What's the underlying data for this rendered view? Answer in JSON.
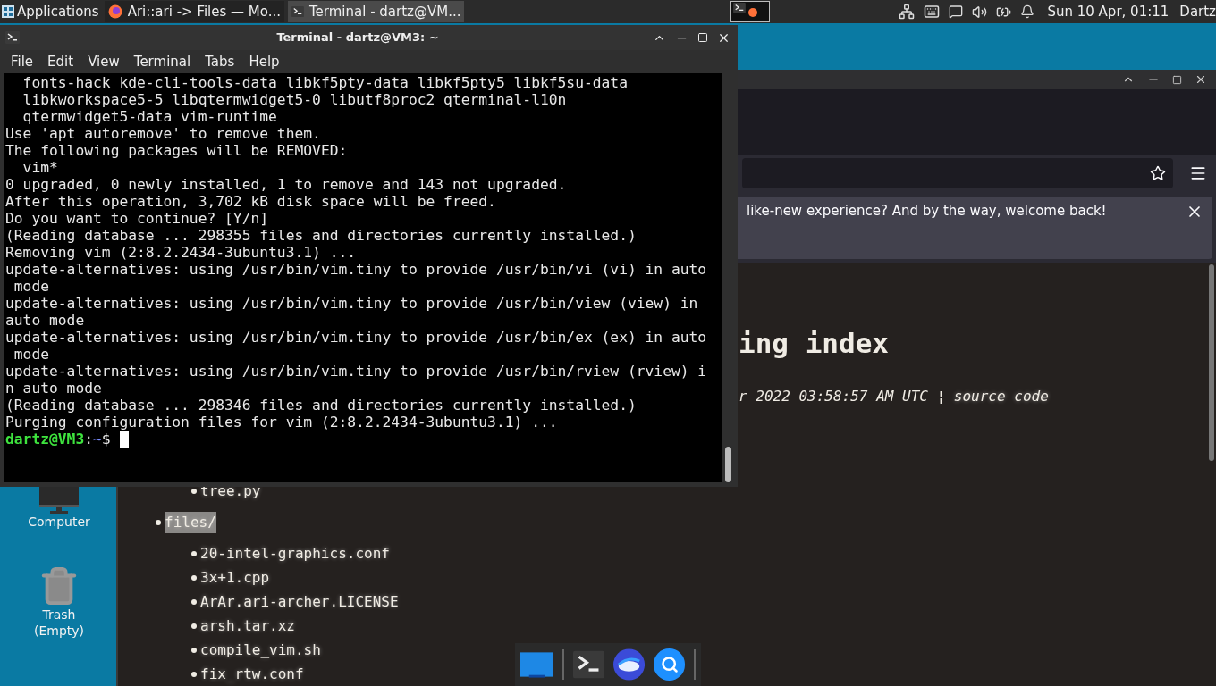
{
  "top_panel": {
    "apps_menu": "Applications",
    "tasks": [
      {
        "title": "Ari::ari -> Files — Mo...",
        "kind": "browser",
        "selected": false
      },
      {
        "title": "Terminal - dartz@VM...",
        "kind": "terminal",
        "selected": true
      }
    ],
    "clock": "Sun 10 Apr, 01:11",
    "user": "Dartz"
  },
  "desktop_icons": [
    {
      "label": "Computer",
      "kind": "computer"
    },
    {
      "label": "Trash (Empty)",
      "kind": "trash"
    }
  ],
  "browser": {
    "notification": "like-new experience? And by the way, welcome back!",
    "heading": "ing index",
    "meta": "r 2022 03:58:57 AM UTC ¦ ",
    "meta_link": "source code",
    "partial_items": [
      "tree.py"
    ],
    "items": [
      {
        "label": "files/",
        "highlighted": true,
        "children": [
          {
            "label": "20-intel-graphics.conf"
          },
          {
            "label": "3x+1.cpp"
          },
          {
            "label": "ArAr.ari-archer.LICENSE"
          },
          {
            "label": "arsh.tar.xz"
          },
          {
            "label": "compile_vim.sh"
          },
          {
            "label": "fix_rtw.conf"
          }
        ]
      }
    ]
  },
  "terminal": {
    "title": "Terminal - dartz@VM3: ~",
    "menu": [
      "File",
      "Edit",
      "View",
      "Terminal",
      "Tabs",
      "Help"
    ],
    "lines": [
      "  fonts-hack kde-cli-tools-data libkf5pty-data libkf5pty5 libkf5su-data",
      "  libkworkspace5-5 libqtermwidget5-0 libutf8proc2 qterminal-l10n",
      "  qtermwidget5-data vim-runtime",
      "Use 'apt autoremove' to remove them.",
      "The following packages will be REMOVED:",
      "  vim*",
      "0 upgraded, 0 newly installed, 1 to remove and 143 not upgraded.",
      "After this operation, 3,702 kB disk space will be freed.",
      "Do you want to continue? [Y/n]",
      "(Reading database ... 298355 files and directories currently installed.)",
      "Removing vim (2:8.2.2434-3ubuntu3.1) ...",
      "update-alternatives: using /usr/bin/vim.tiny to provide /usr/bin/vi (vi) in auto",
      " mode",
      "update-alternatives: using /usr/bin/vim.tiny to provide /usr/bin/view (view) in",
      "auto mode",
      "update-alternatives: using /usr/bin/vim.tiny to provide /usr/bin/ex (ex) in auto",
      " mode",
      "update-alternatives: using /usr/bin/vim.tiny to provide /usr/bin/rview (rview) i",
      "n auto mode",
      "(Reading database ... 298346 files and directories currently installed.)",
      "Purging configuration files for vim (2:8.2.2434-3ubuntu3.1) ..."
    ],
    "prompt": {
      "user_host": "dartz@VM3",
      "separator": ":",
      "path": "~",
      "symbol": "$"
    }
  }
}
